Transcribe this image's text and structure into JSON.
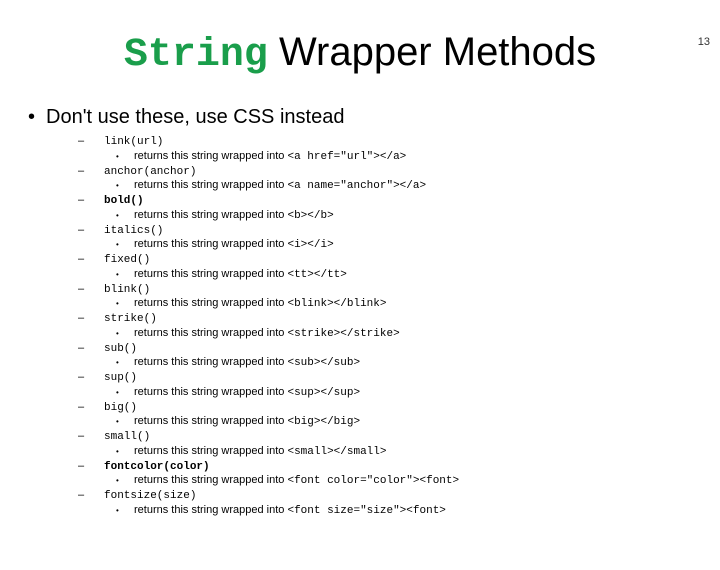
{
  "page_number": "13",
  "title_code": "String",
  "title_rest": " Wrapper Methods",
  "lvl1_text": "Don't use these, use CSS instead",
  "desc_prefix": "returns this string wrapped into ",
  "methods": [
    {
      "name": "link(url)",
      "bold": false,
      "tag": "<a href=\"url\"></a>"
    },
    {
      "name": "anchor(anchor)",
      "bold": false,
      "tag": "<a name=\"anchor\"></a>"
    },
    {
      "name": "bold()",
      "bold": true,
      "tag": "<b></b>"
    },
    {
      "name": "italics()",
      "bold": false,
      "tag": "<i></i>"
    },
    {
      "name": "fixed()",
      "bold": false,
      "tag": "<tt></tt>"
    },
    {
      "name": "blink()",
      "bold": false,
      "tag": "<blink></blink>"
    },
    {
      "name": "strike()",
      "bold": false,
      "tag": "<strike></strike>"
    },
    {
      "name": "sub()",
      "bold": false,
      "tag": "<sub></sub>"
    },
    {
      "name": "sup()",
      "bold": false,
      "tag": "<sup></sup>"
    },
    {
      "name": "big()",
      "bold": false,
      "tag": "<big></big>"
    },
    {
      "name": "small()",
      "bold": false,
      "tag": "<small></small>"
    },
    {
      "name": "fontcolor(color)",
      "bold": true,
      "tag": "<font color=\"color\"><font>"
    },
    {
      "name": "fontsize(size)",
      "bold": false,
      "tag": "<font size=\"size\"><font>"
    }
  ]
}
